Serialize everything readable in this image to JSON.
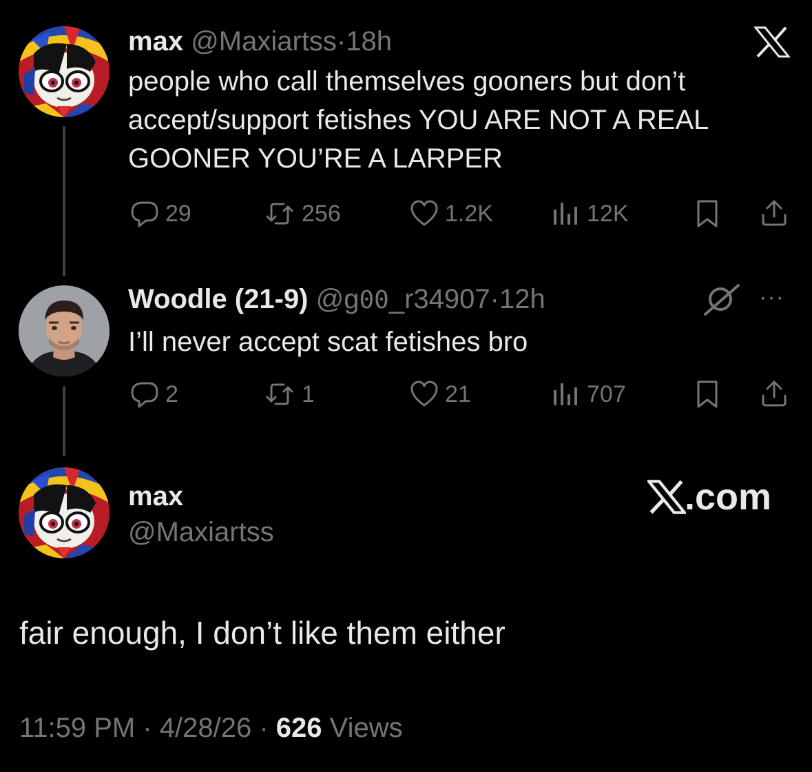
{
  "tweets": [
    {
      "name": "max",
      "handle": "@Maxiartss",
      "separator": "·",
      "time": "18h",
      "text_lines": [
        "people who call themselves gooners but don’t",
        "accept/support fetishes YOU ARE NOT A REAL",
        "GOONER YOU’RE A LARPER"
      ],
      "stats": {
        "replies": "29",
        "reposts": "256",
        "likes": "1.2K",
        "views": "12K"
      }
    },
    {
      "name": "Woodle (21-9)",
      "handle_prefix": "@g",
      "handle_mono": "00",
      "handle_suffix": "_r34907",
      "separator": "·",
      "time": "12h",
      "text": "I’ll never accept scat fetishes bro",
      "more": "···",
      "stats": {
        "replies": "2",
        "reposts": "1",
        "likes": "21",
        "views": "707"
      }
    }
  ],
  "main_post": {
    "name": "max",
    "handle": "@Maxiartss",
    "brand": "X.com",
    "text": "fair enough, I don’t like them either",
    "timestamp": "11:59 PM · 4/28/26 · ",
    "views_count": "626",
    "views_label": " Views"
  },
  "icons": {
    "x_logo": "x-logo",
    "reply": "reply-icon",
    "repost": "repost-icon",
    "like": "heart-icon",
    "views": "views-icon",
    "bookmark": "bookmark-icon",
    "share": "share-icon",
    "grok": "grok-icon"
  },
  "colors": {
    "background": "#000000",
    "text": "#e7e9ea",
    "muted": "#71767b",
    "thread_line": "#3e4144"
  }
}
